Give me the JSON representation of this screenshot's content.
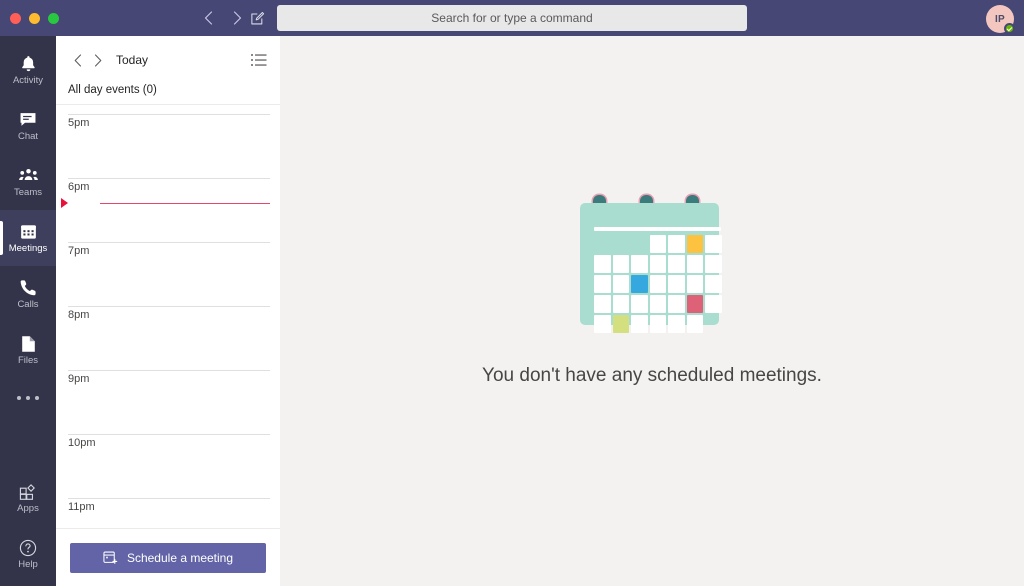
{
  "titlebar": {
    "back_icon": "chevron-left-icon",
    "forward_icon": "chevron-right-icon",
    "compose_icon": "compose-icon",
    "accent": "#464775"
  },
  "search": {
    "placeholder": "Search for or type a command",
    "value": "Search for or type a command"
  },
  "user": {
    "initials": "IP",
    "presence": "available",
    "presence_color": "#6bb700",
    "avatar_color": "#f3c7c0"
  },
  "rail": {
    "items": [
      {
        "label": "Activity",
        "icon": "bell-icon",
        "active": false
      },
      {
        "label": "Chat",
        "icon": "chat-icon",
        "active": false
      },
      {
        "label": "Teams",
        "icon": "teams-icon",
        "active": false
      },
      {
        "label": "Meetings",
        "icon": "calendar-icon",
        "active": true
      },
      {
        "label": "Calls",
        "icon": "phone-icon",
        "active": false
      },
      {
        "label": "Files",
        "icon": "file-icon",
        "active": false
      }
    ],
    "more_icon": "ellipsis-icon",
    "bottom_items": [
      {
        "label": "Apps",
        "icon": "apps-icon"
      },
      {
        "label": "Help",
        "icon": "help-icon"
      }
    ]
  },
  "agenda": {
    "prev_icon": "chevron-left-icon",
    "next_icon": "chevron-right-icon",
    "title": "Today",
    "list_view_icon": "agenda-list-icon",
    "all_day_label": "All day events (0)",
    "hours": [
      "5pm",
      "6pm",
      "7pm",
      "8pm",
      "9pm",
      "10pm",
      "11pm"
    ],
    "current_time_color": "#e8476d",
    "schedule_button": {
      "label": "Schedule a meeting",
      "icon": "calendar-add-icon",
      "color": "#6264a7"
    }
  },
  "main": {
    "empty_message": "You don't have any scheduled meetings.",
    "illustration": {
      "name": "calendar-illustration",
      "body_color": "#a8ddd0",
      "ring_color": "#3c7b7b",
      "cells": [
        [
          "empty",
          "empty",
          "empty",
          "white",
          "white",
          "yellow",
          "white"
        ],
        [
          "white",
          "white",
          "white",
          "white",
          "white",
          "white",
          "white"
        ],
        [
          "white",
          "white",
          "blue",
          "white",
          "white",
          "white",
          "white"
        ],
        [
          "white",
          "white",
          "white",
          "white",
          "white",
          "pink",
          "white"
        ],
        [
          "white",
          "green",
          "white",
          "white",
          "white",
          "white",
          "empty"
        ]
      ],
      "cell_colors": {
        "white": "#ffffff",
        "yellow": "#fdc23f",
        "blue": "#35a8e0",
        "pink": "#dd6277",
        "green": "#d4e07f"
      }
    }
  }
}
